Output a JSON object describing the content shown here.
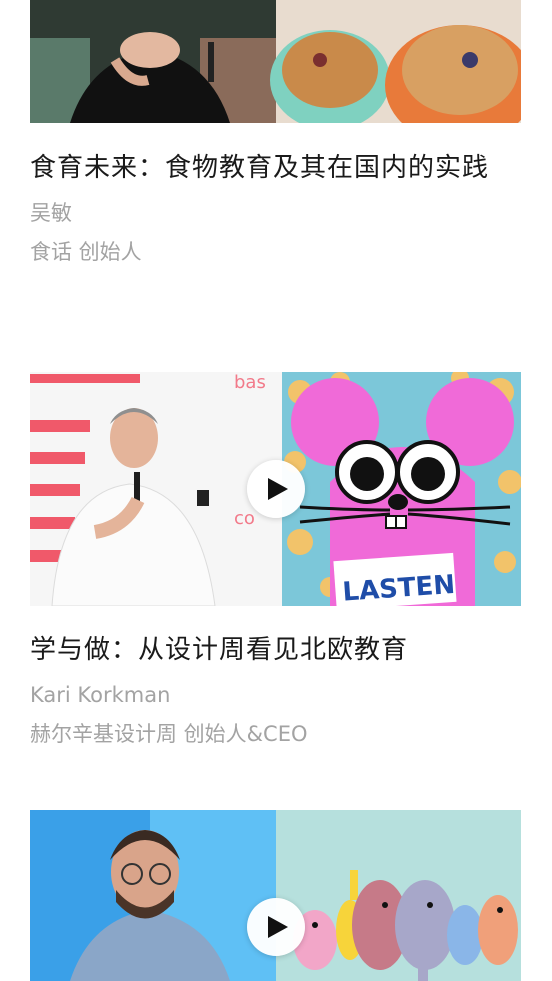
{
  "articles": [
    {
      "title": "食育未来：食物教育及其在国内的实践",
      "speaker": "吴敏",
      "role": "食话 创始人"
    },
    {
      "title": "学与做：从设计周看见北欧教育",
      "speaker": "Kari Korkman",
      "role": "赫尔辛基设计周 创始人&CEO",
      "thumbnail_text": {
        "slide_top": "bas",
        "slide_mid": "co",
        "poster": "LASTEN"
      }
    },
    {
      "title": "",
      "speaker": "",
      "role": ""
    }
  ],
  "colors": {
    "title": "#1a1a1a",
    "meta": "#a3a3a3",
    "poster_pink": "#f06ad8",
    "poster_bg": "#7cc7d9",
    "teal_bg": "#b6e0dd",
    "stage_blue": "#3aa0e8"
  },
  "icons": [
    "play-icon",
    "play-icon"
  ]
}
